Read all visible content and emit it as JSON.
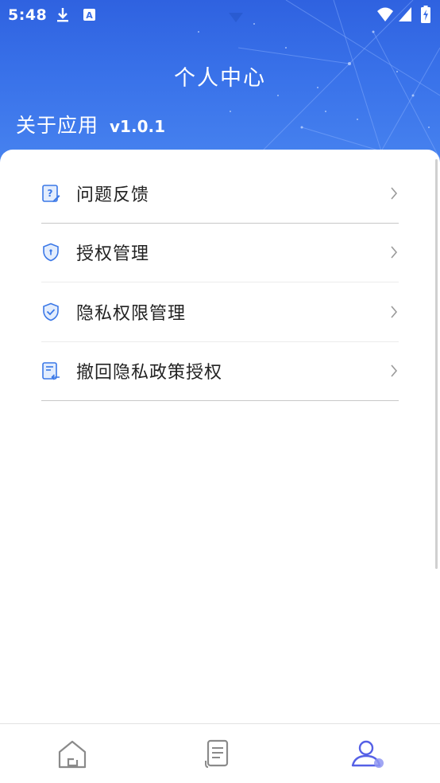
{
  "status_bar": {
    "time": "5:48",
    "left_icons": [
      "download-icon",
      "a-notification-icon"
    ],
    "right_icons": [
      "wifi-icon",
      "signal-icon",
      "battery-charging-icon"
    ]
  },
  "header": {
    "title": "个人中心",
    "about_label": "关于应用",
    "version": "v1.0.1"
  },
  "menu": {
    "items": [
      {
        "label": "问题反馈",
        "icon": "feedback-icon"
      },
      {
        "label": "授权管理",
        "icon": "shield-icon"
      },
      {
        "label": "隐私权限管理",
        "icon": "shield-check-icon"
      },
      {
        "label": "撤回隐私政策授权",
        "icon": "revoke-document-icon"
      }
    ]
  },
  "bottom_nav": {
    "items": [
      {
        "icon": "home-icon",
        "active": false
      },
      {
        "icon": "document-icon",
        "active": false
      },
      {
        "icon": "profile-icon",
        "active": true
      }
    ]
  },
  "colors": {
    "header_blue": "#3a73ea",
    "icon_blue": "#3b78e7",
    "active_nav": "#5560e6"
  }
}
